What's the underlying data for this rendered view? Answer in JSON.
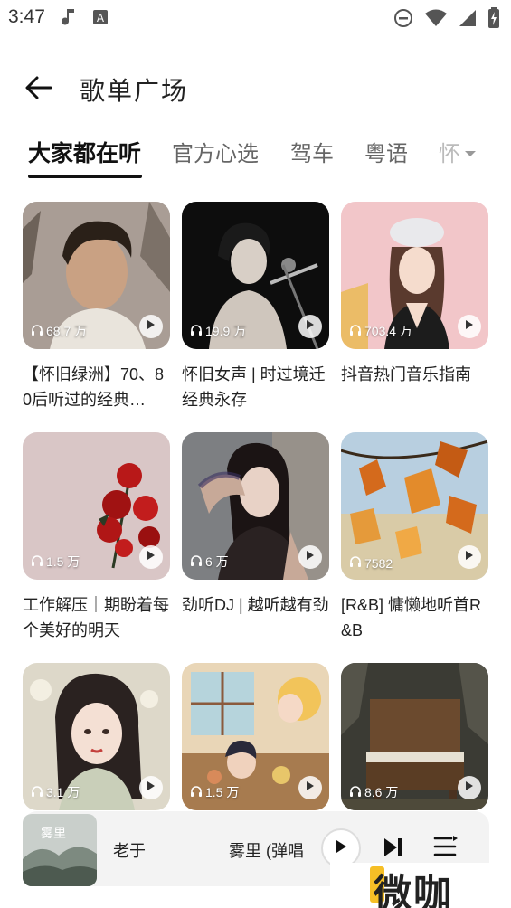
{
  "status_bar": {
    "time": "3:47",
    "icons": [
      "music-note-icon",
      "keyboard-a-icon",
      "do-not-disturb-icon",
      "wifi-icon",
      "signal-icon",
      "battery-charging-icon"
    ]
  },
  "header": {
    "title": "歌单广场",
    "back_icon": "arrow-left-icon"
  },
  "tabs": [
    {
      "label": "大家都在听",
      "active": true
    },
    {
      "label": "官方心选",
      "active": false
    },
    {
      "label": "驾车",
      "active": false
    },
    {
      "label": "粤语",
      "active": false
    },
    {
      "label": "怀",
      "active": false
    }
  ],
  "playlists": [
    {
      "title": "【怀旧绿洲】70、80后听过的经典…",
      "plays": "68.7 万",
      "cover": "portrait-man"
    },
    {
      "title": "怀旧女声 | 时过境迁 经典永存",
      "plays": "19.9 万",
      "cover": "singer-mic"
    },
    {
      "title": "抖音热门音乐指南",
      "plays": "703.4 万",
      "cover": "girl-hat"
    },
    {
      "title": "工作解压｜期盼着每个美好的明天",
      "plays": "1.5 万",
      "cover": "red-roses"
    },
    {
      "title": "劲听DJ | 越听越有劲",
      "plays": "6 万",
      "cover": "tattoo-girl"
    },
    {
      "title": "[R&B] 慵懒地听首R&B",
      "plays": "7582",
      "cover": "autumn-leaves"
    },
    {
      "title": "",
      "plays": "3.1 万",
      "cover": "illustrated-girl"
    },
    {
      "title": "",
      "plays": "1.5 万",
      "cover": "anime-scene"
    },
    {
      "title": "",
      "plays": "8.6 万",
      "cover": "old-piano"
    }
  ],
  "mini_player": {
    "artist": "老于",
    "song": "雾里 (弹唱",
    "cover_text": "雾里"
  },
  "watermark": {
    "text": "微咖"
  },
  "colors": {
    "accent": "#111111",
    "inactive_tab": "#666666",
    "player_bg": "#f3f3f3"
  }
}
